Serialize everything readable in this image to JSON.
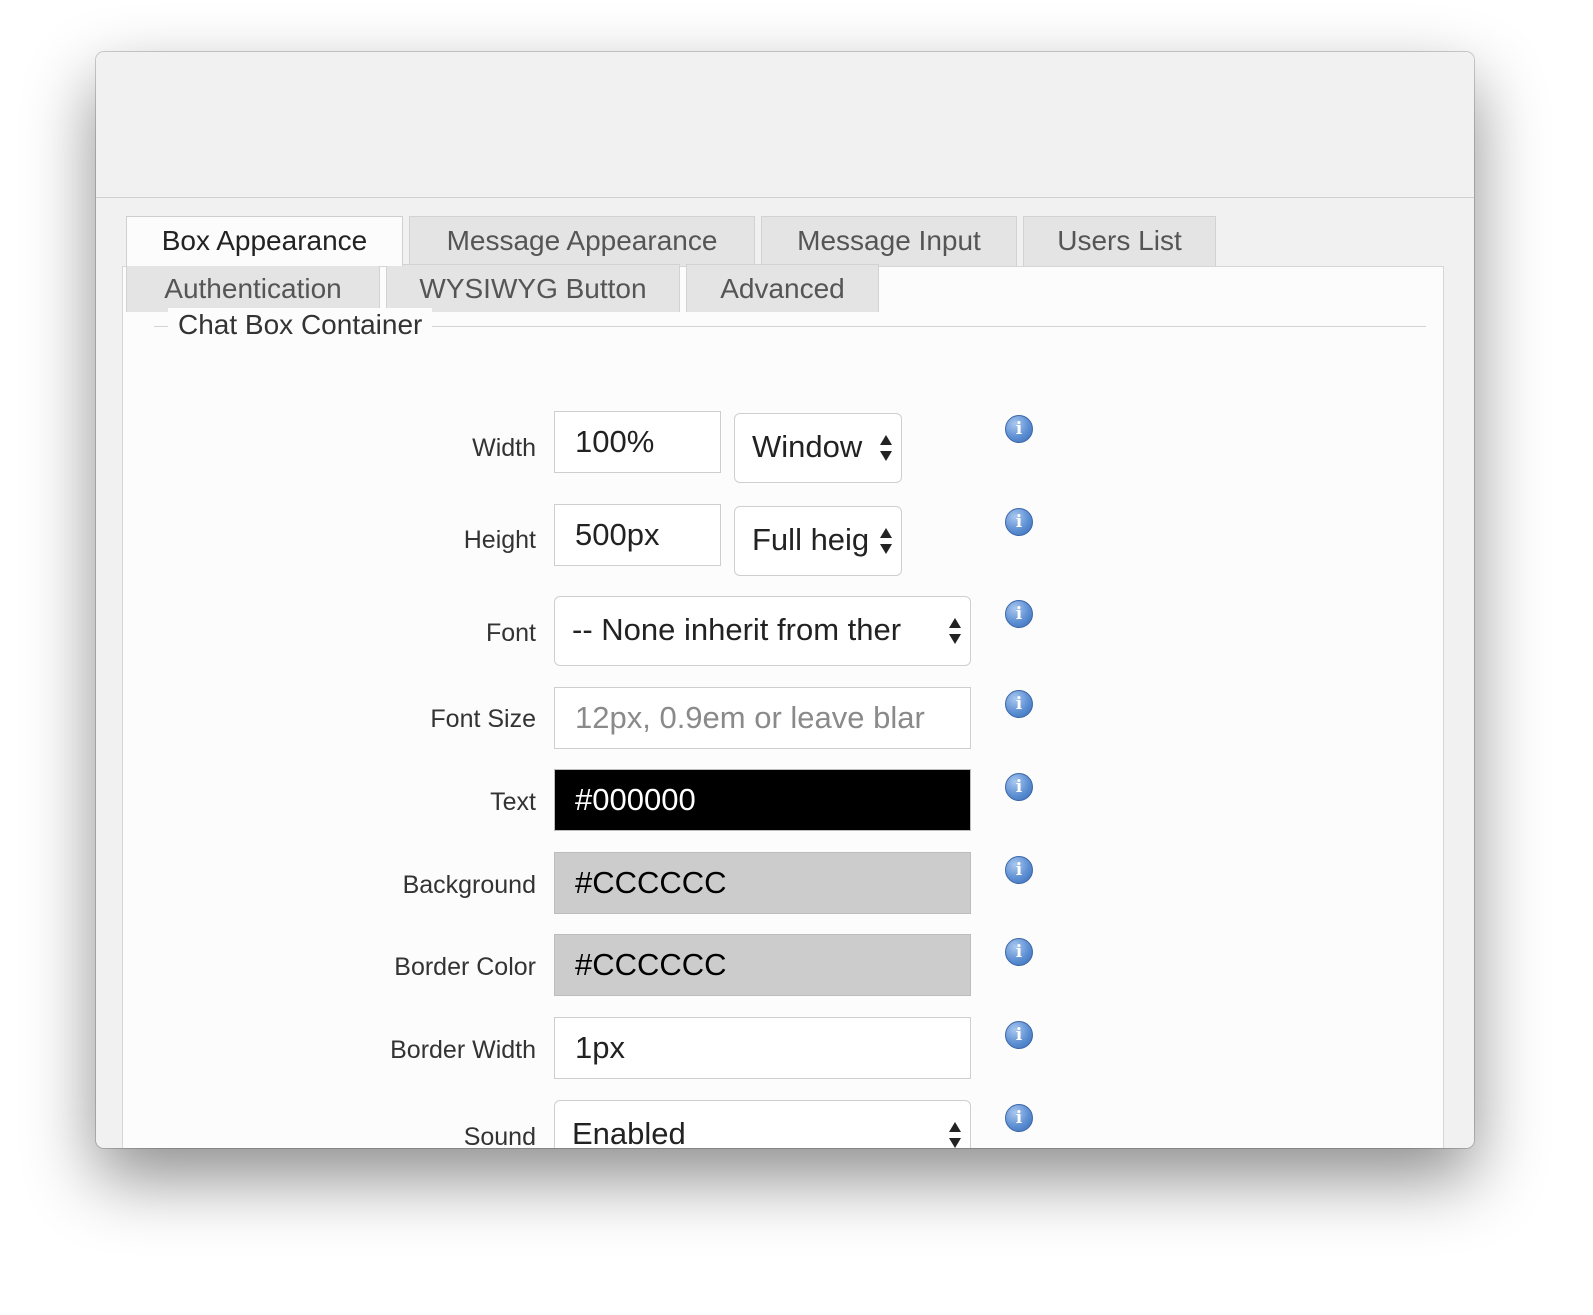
{
  "tabs": [
    {
      "label": "Box Appearance",
      "active": true
    },
    {
      "label": "Message Appearance",
      "active": false
    },
    {
      "label": "Message Input",
      "active": false
    },
    {
      "label": "Users List",
      "active": false
    },
    {
      "label": "Authentication",
      "active": false
    },
    {
      "label": "WYSIWYG Button",
      "active": false
    },
    {
      "label": "Advanced",
      "active": false
    }
  ],
  "section": {
    "legend": "Chat Box Container"
  },
  "fields": {
    "width": {
      "label": "Width",
      "value": "100%",
      "unit": "Window"
    },
    "height": {
      "label": "Height",
      "value": "500px",
      "unit": "Full heig"
    },
    "font": {
      "label": "Font",
      "value": "-- None inherit from ther"
    },
    "font_size": {
      "label": "Font Size",
      "value": "",
      "placeholder": "12px, 0.9em or leave blar"
    },
    "text": {
      "label": "Text",
      "value": "#000000",
      "bg": "#000000",
      "fg": "#FFFFFF"
    },
    "background": {
      "label": "Background",
      "value": "#CCCCCC",
      "bg": "#CCCCCC",
      "fg": "#000000"
    },
    "border_color": {
      "label": "Border Color",
      "value": "#CCCCCC",
      "bg": "#CCCCCC",
      "fg": "#000000"
    },
    "border_width": {
      "label": "Border Width",
      "value": "1px"
    },
    "sound": {
      "label": "Sound",
      "value": "Enabled"
    }
  },
  "info_icon": {
    "symbol": "i",
    "color": "#5d8fd3"
  }
}
